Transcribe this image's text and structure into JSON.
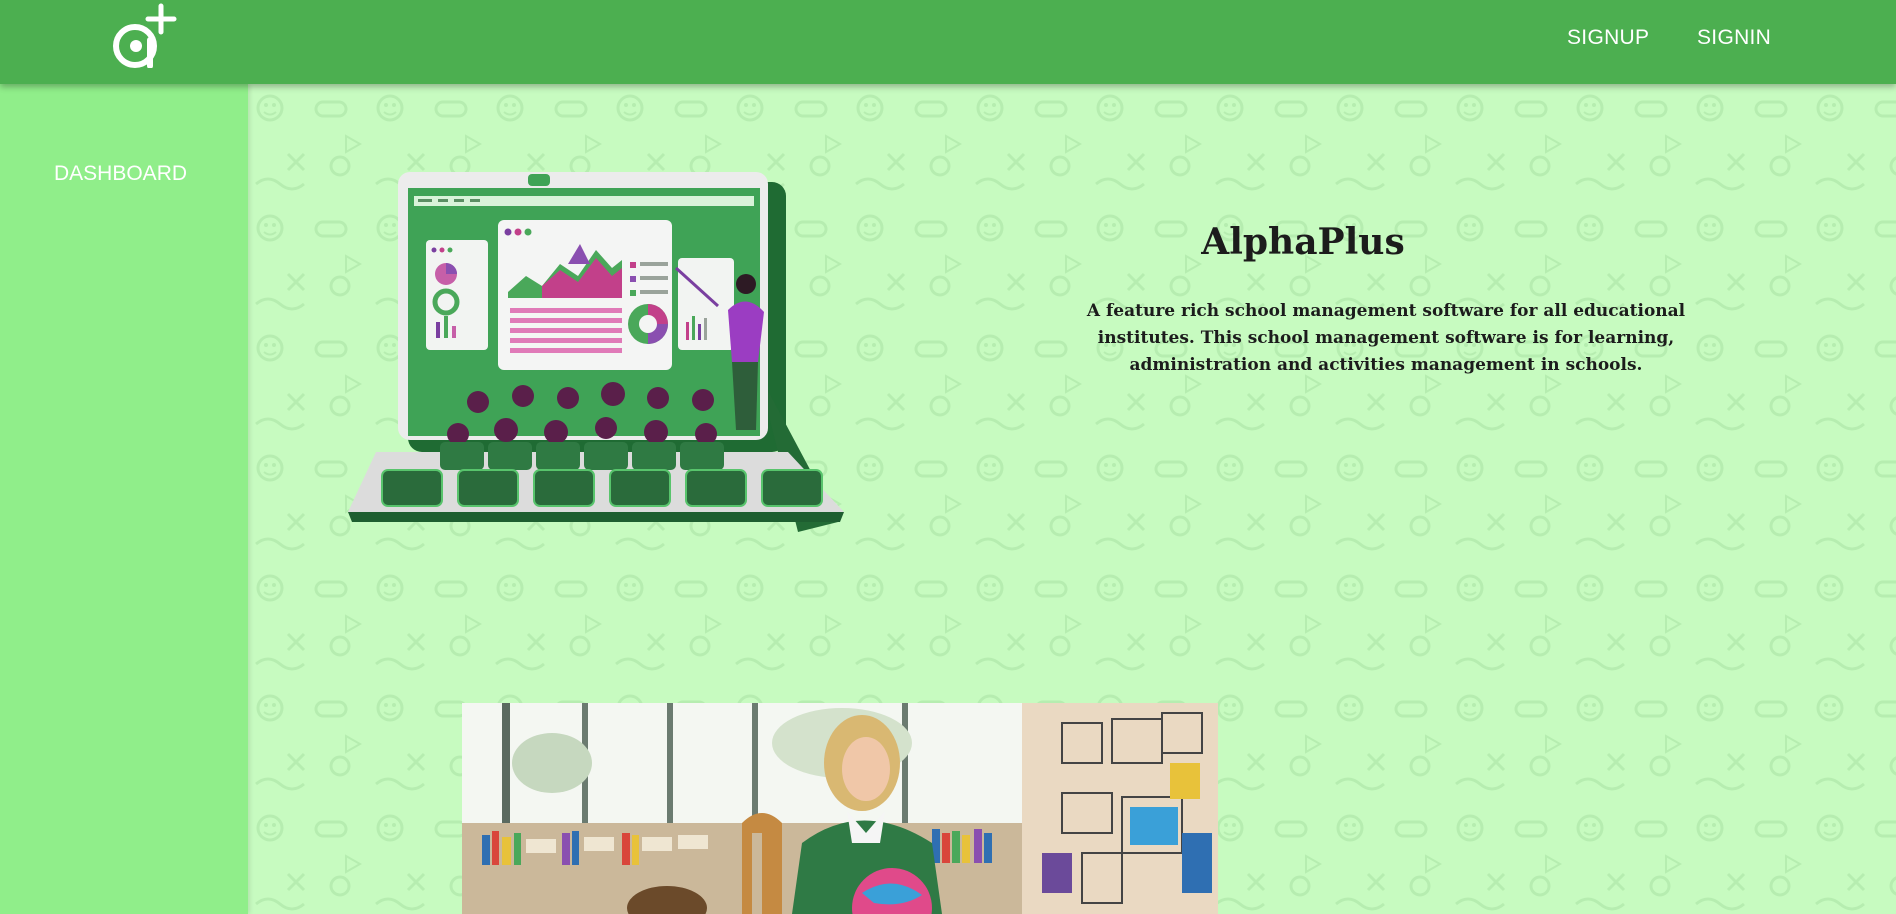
{
  "header": {
    "logo_icon": "alphaplus-logo-icon",
    "signup_label": "SIGNUP",
    "signin_label": "SIGNIN"
  },
  "sidebar": {
    "items": [
      {
        "label": "DASHBOARD"
      }
    ]
  },
  "hero": {
    "title": "AlphaPlus",
    "description": "A feature rich school management software for all educational institutes. This school management software is for learning, administration and activities management in schools.",
    "illustration_icon": "laptop-classroom-illustration"
  },
  "photo": {
    "icon": "teacher-classroom-photo"
  },
  "colors": {
    "header": "#4caf50",
    "sidebar": "#90ee8a",
    "main_background": "#c7fbc0",
    "text": "#1c1c1c"
  }
}
